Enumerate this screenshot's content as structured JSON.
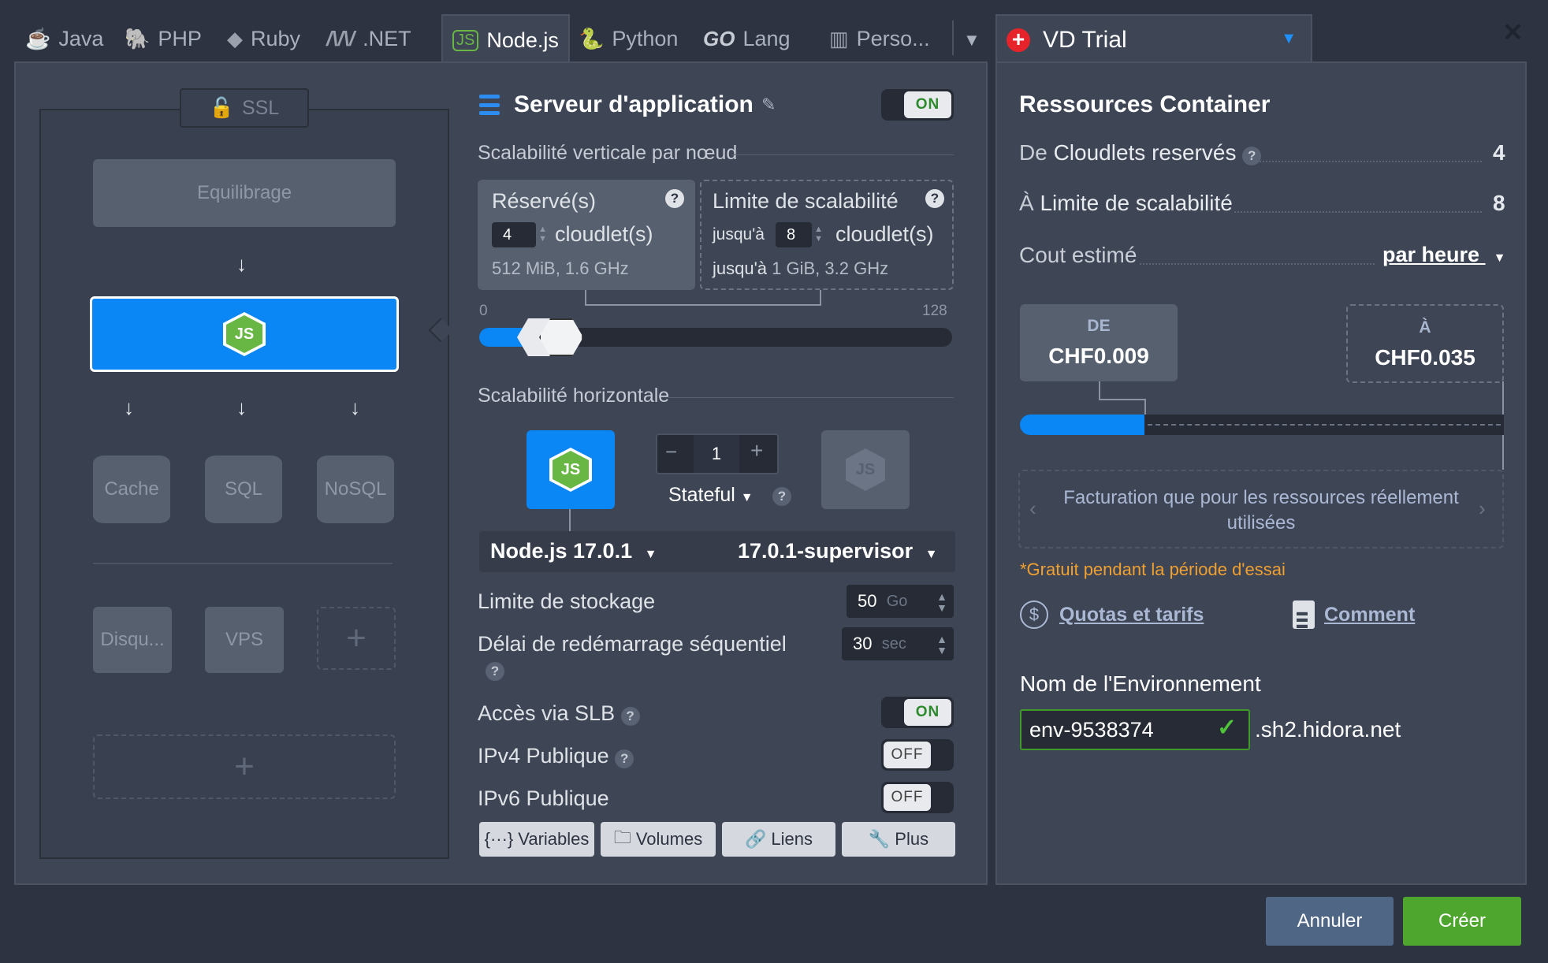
{
  "tabs": [
    {
      "label": "Java",
      "icon": "java-icon"
    },
    {
      "label": "PHP",
      "icon": "php-icon"
    },
    {
      "label": "Ruby",
      "icon": "ruby-icon"
    },
    {
      "label": ".NET",
      "icon": "dotnet-icon"
    },
    {
      "label": "Node.js",
      "icon": "nodejs-icon"
    },
    {
      "label": "Python",
      "icon": "python-icon"
    },
    {
      "label": "Lang",
      "icon": "go-icon"
    },
    {
      "label": "Perso...",
      "icon": "custom-icon"
    }
  ],
  "go_text": "GO",
  "env_tab": {
    "label": "VD Trial",
    "flag_color": "#e6232a"
  },
  "topology": {
    "ssl": "SSL",
    "balancer": "Equilibrage",
    "cache": "Cache",
    "sql": "SQL",
    "nosql": "NoSQL",
    "disk": "Disqu...",
    "vps": "VPS",
    "plus": "+",
    "node_badge": "JS"
  },
  "server": {
    "title": "Serveur d'application",
    "toggle": "ON",
    "vertical_title": "Scalabilité verticale par nœud",
    "reserved_title": "Réservé(s)",
    "reserved_value": "4",
    "cloudlets_label": "cloudlet(s)",
    "reserved_spec": "512 MiB, 1.6 GHz",
    "limit_title": "Limite de scalabilité",
    "upto": "jusqu'à",
    "limit_value": "8",
    "limit_spec_prefix": "jusqu'à",
    "limit_spec": "1 GiB, 3.2 GHz",
    "slider_min": "0",
    "slider_max": "128",
    "horizontal_title": "Scalabilité horizontale",
    "node_count": "1",
    "minus": "−",
    "plus": "+",
    "stateful": "Stateful",
    "version": "Node.js 17.0.1",
    "tag": "17.0.1-supervisor",
    "storage_label": "Limite de stockage",
    "storage_value": "50",
    "storage_unit": "Go",
    "restart_label": "Délai de redémarrage séquentiel",
    "restart_value": "30",
    "restart_unit": "sec",
    "slb_label": "Accès via SLB",
    "slb_toggle": "ON",
    "ipv4_label": "IPv4 Publique",
    "ipv4_toggle": "OFF",
    "ipv6_label": "IPv6 Publique",
    "ipv6_toggle": "OFF",
    "buttons": [
      "Variables",
      "Volumes",
      "Liens",
      "Plus"
    ]
  },
  "resources": {
    "title": "Ressources Container",
    "reserved_prefix": "De",
    "reserved_label": "Cloudlets reservés",
    "reserved_value": "4",
    "limit_prefix": "À",
    "limit_label": "Limite de scalabilité",
    "limit_value": "8",
    "cost_label": "Cout estimé",
    "cost_period": "par heure",
    "from_label": "DE",
    "from_price": "CHF0.009",
    "to_label": "À",
    "to_price": "CHF0.035",
    "billing_note": "Facturation que pour les ressources réellement utilisées",
    "trial_note": "*Gratuit pendant la période d'essai",
    "quotas_link": "Quotas et tarifs",
    "how_link": "Comment",
    "env_name_label": "Nom de l'Environnement",
    "env_name_value": "env-9538374",
    "domain_suffix": ".sh2.hidora.net"
  },
  "footer": {
    "cancel": "Annuler",
    "create": "Créer"
  },
  "close": "✕",
  "colors": {
    "accent_blue": "#0b86f5",
    "create_green": "#4fa62f",
    "cancel_blue": "#4f6685",
    "trial_orange": "#f0a030"
  }
}
